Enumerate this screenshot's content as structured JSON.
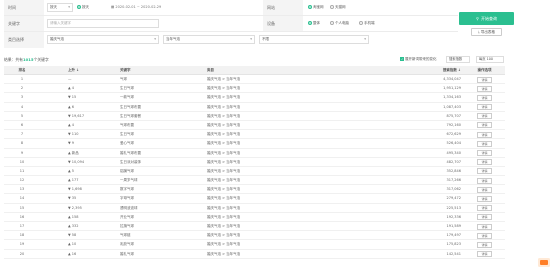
{
  "filters": {
    "date": {
      "label": "时间",
      "mode": "按天",
      "mode_options": [
        {
          "label": "按天",
          "on": true
        },
        {
          "label": "按周",
          "on": false
        }
      ],
      "range": "2020-02-01 ~ 2020-02-29"
    },
    "keyword": {
      "label": "关键字",
      "placeholder": "请输入关键字"
    },
    "category": {
      "label": "类目选择",
      "level1": "婚庆气泡",
      "level2": "当年气泡",
      "level3": "不限"
    },
    "platform": {
      "label": "网站",
      "options": [
        {
          "label": "淘宝网",
          "on": true
        },
        {
          "label": "天猫网",
          "on": false
        }
      ]
    },
    "device": {
      "label": "设备",
      "options": [
        {
          "label": "整体",
          "on": true
        },
        {
          "label": "个人电脑",
          "on": false
        },
        {
          "label": "手机端",
          "on": false
        }
      ]
    },
    "query_button": "开始查询",
    "export_button": "导出表格"
  },
  "result": {
    "prefix": "结果：共有",
    "count": "1015",
    "suffix": "个关键字",
    "checkbox_label": "展开新词带来的变化",
    "sort_select": "搜索指数",
    "page_size": "每页 100"
  },
  "table": {
    "headers": [
      "排名",
      "上升 ↓",
      "关键字",
      "类目",
      "搜索指数 ↓",
      "操作选项"
    ],
    "action_label": "详情",
    "rows": [
      {
        "rank": "1",
        "change": "—",
        "dir": "flat",
        "keyword": "气球",
        "category": "婚庆气泡 > 当年气泡",
        "search": "4,334,047"
      },
      {
        "rank": "2",
        "change": "▲ 4",
        "dir": "up",
        "keyword": "生日气球",
        "category": "婚庆气泡 > 当年气泡",
        "search": "1,951,129"
      },
      {
        "rank": "3",
        "change": "▼ 15",
        "dir": "up",
        "keyword": "一款气球",
        "category": "婚庆气泡 > 当年气泡",
        "search": "1,334,163"
      },
      {
        "rank": "4",
        "change": "▲ 6",
        "dir": "up",
        "keyword": "生日气球布置",
        "category": "婚庆气泡 > 当年气泡",
        "search": "1,087,403"
      },
      {
        "rank": "5",
        "change": "▼ 19,617",
        "dir": "up",
        "keyword": "生日气球套餐",
        "category": "婚庆气泡 > 当年气泡",
        "search": "875,707"
      },
      {
        "rank": "6",
        "change": "▲ 4",
        "dir": "down",
        "keyword": "气球布置",
        "category": "婚庆气泡 > 当年气泡",
        "search": "792,160"
      },
      {
        "rank": "7",
        "change": "▼ 110",
        "dir": "down",
        "keyword": "生日气球",
        "category": "婚庆气泡 > 当年气泡",
        "search": "672,629"
      },
      {
        "rank": "8",
        "change": "▼ 9",
        "dir": "up",
        "keyword": "爱心气球",
        "category": "婚庆气泡 > 当年气泡",
        "search": "526,404"
      },
      {
        "rank": "9",
        "change": "▲ 新品",
        "dir": "new",
        "keyword": "婚礼气球布置",
        "category": "婚庆气泡 > 当年气泡",
        "search": "495,340"
      },
      {
        "rank": "10",
        "change": "▼ 10,094",
        "dir": "up",
        "keyword": "生日派对装饰",
        "category": "婚庆气泡 > 当年气泡",
        "search": "482,707"
      },
      {
        "rank": "11",
        "change": "▲ 5",
        "dir": "down",
        "keyword": "铝膜气球",
        "category": "婚庆气泡 > 当年气泡",
        "search": "352,846"
      },
      {
        "rank": "12",
        "change": "▲ 177",
        "dir": "up",
        "keyword": "一周岁气球",
        "category": "婚庆气泡 > 当年气泡",
        "search": "317,266"
      },
      {
        "rank": "13",
        "change": "▼ 1,698",
        "dir": "up",
        "keyword": "数字气球",
        "category": "婚庆气泡 > 当年气泡",
        "search": "317,062"
      },
      {
        "rank": "14",
        "change": "▼ 35",
        "dir": "up",
        "keyword": "字母气球",
        "category": "婚庆气泡 > 当年气泡",
        "search": "279,472"
      },
      {
        "rank": "15",
        "change": "▼ 2,395",
        "dir": "up",
        "keyword": "透明波波球",
        "category": "婚庆气泡 > 当年气泡",
        "search": "225,513"
      },
      {
        "rank": "16",
        "change": "▲ 158",
        "dir": "up",
        "keyword": "开业气球",
        "category": "婚庆气泡 > 当年气泡",
        "search": "192,336"
      },
      {
        "rank": "17",
        "change": "▲ 332",
        "dir": "up",
        "keyword": "拉旗气球",
        "category": "婚庆气泡 > 当年气泡",
        "search": "191,589"
      },
      {
        "rank": "18",
        "change": "▼ 58",
        "dir": "up",
        "keyword": "气球链",
        "category": "婚庆气泡 > 当年气泡",
        "search": "179,497"
      },
      {
        "rank": "19",
        "change": "▲ 10",
        "dir": "down",
        "keyword": "乳胶气球",
        "category": "婚庆气泡 > 当年气泡",
        "search": "175,823"
      },
      {
        "rank": "20",
        "change": "▲ 16",
        "dir": "down",
        "keyword": "婚礼气球",
        "category": "婚庆气泡 > 当年气泡",
        "search": "142,541"
      }
    ]
  },
  "colors": {
    "accent": "#2bbf90",
    "up": "#e34a4a",
    "down": "#4a8de3",
    "new": "#ff7e27"
  }
}
